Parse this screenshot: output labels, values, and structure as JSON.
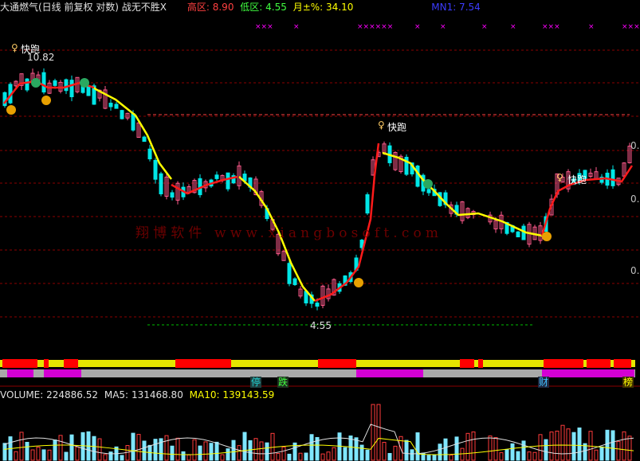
{
  "header": {
    "title": "大通燃气(日线 前复权 对数) 战无不胜X",
    "high_label": "高区:",
    "high_value": "8.90",
    "low_label": "低区:",
    "low_value": "4.55",
    "month_label": "月±%:",
    "month_value": "34.10",
    "mn_label": "MN1: 7.54"
  },
  "annotations": {
    "peak_price": "10.82",
    "low_price": "4:55",
    "signal_run": "快跑",
    "watermark": "翔博软件 www.xiangbosoft.com",
    "right_tick_1": "0.",
    "right_tick_2": "0.",
    "right_tick_3": "0."
  },
  "bands": {
    "tag_stop": "停",
    "tag_fall": "跌",
    "tag_wealth": "财",
    "tag_rank": "榜"
  },
  "volume": {
    "label": "VOLUME:",
    "value": "224886.52",
    "ma5_label": "MA5:",
    "ma5_value": "131468.80",
    "ma10_label": "MA10:",
    "ma10_value": "139143.59"
  },
  "colors": {
    "up": "#ff3c3c",
    "down": "#00e6e6",
    "yellow": "#ffff00",
    "magenta": "#ff00ff",
    "blue": "#3c3cff"
  }
}
